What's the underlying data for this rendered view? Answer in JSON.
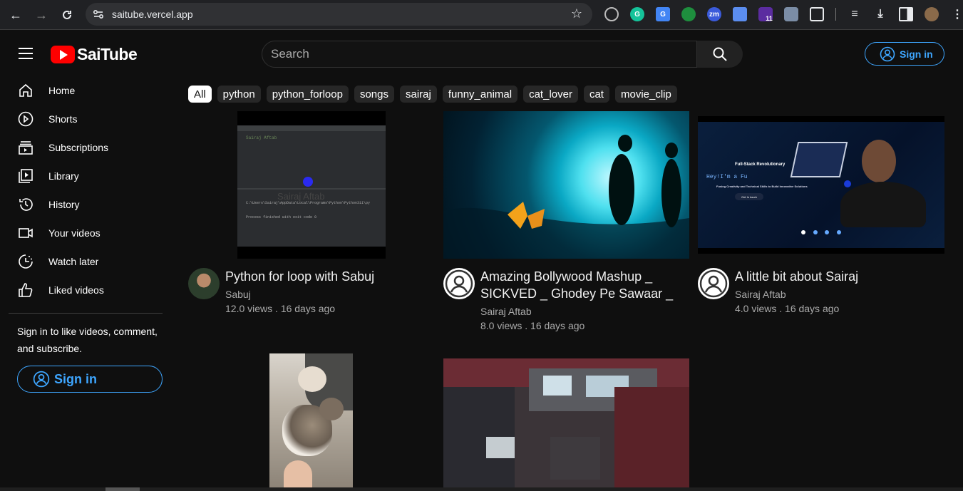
{
  "browser": {
    "url": "saitube.vercel.app",
    "ext_badge": "11"
  },
  "header": {
    "brand": "SaiTube",
    "search_placeholder": "Search",
    "signin_label": "Sign in"
  },
  "sidebar": {
    "items": [
      {
        "label": "Home",
        "icon": "home-icon"
      },
      {
        "label": "Shorts",
        "icon": "shorts-icon"
      },
      {
        "label": "Subscriptions",
        "icon": "subscriptions-icon"
      },
      {
        "label": "Library",
        "icon": "library-icon"
      },
      {
        "label": "History",
        "icon": "history-icon"
      },
      {
        "label": "Your videos",
        "icon": "your-videos-icon"
      },
      {
        "label": "Watch later",
        "icon": "watch-later-icon"
      },
      {
        "label": "Liked videos",
        "icon": "liked-videos-icon"
      }
    ],
    "signin_prompt": "Sign in to like videos, comment, and subscribe.",
    "signin_label": "Sign in"
  },
  "chips": [
    "All",
    "python",
    "python_forloop",
    "songs",
    "sairaj",
    "funny_animal",
    "cat_lover",
    "cat",
    "movie_clip"
  ],
  "thumb_texts": {
    "code_watermark": "Sairaj Aftab",
    "code_path": "C:\\Users\\Sairaj\\AppData\\Local\\Programs\\Python\\Python311\\py",
    "code_output": "Process finished with exit code 0",
    "promo_heading": "Full-Stack Revolutionary",
    "promo_intro": "Hey!I'm a Fu",
    "promo_sub": "Fusing Creativity and Technical Skills to Build Innovative Solutions",
    "promo_button": "Get In touch"
  },
  "videos": [
    {
      "title": "Python for loop with Sabuj",
      "channel": "Sabuj",
      "meta": "12.0 views . 16 days ago"
    },
    {
      "title": "Amazing Bollywood Mashup _ SICKVED _ Ghodey Pe Sawaar _ Ek...",
      "channel": "Sairaj Aftab",
      "meta": "8.0 views . 16 days ago"
    },
    {
      "title": "A little bit about Sairaj",
      "channel": "Sairaj Aftab",
      "meta": "4.0 views . 16 days ago"
    }
  ]
}
